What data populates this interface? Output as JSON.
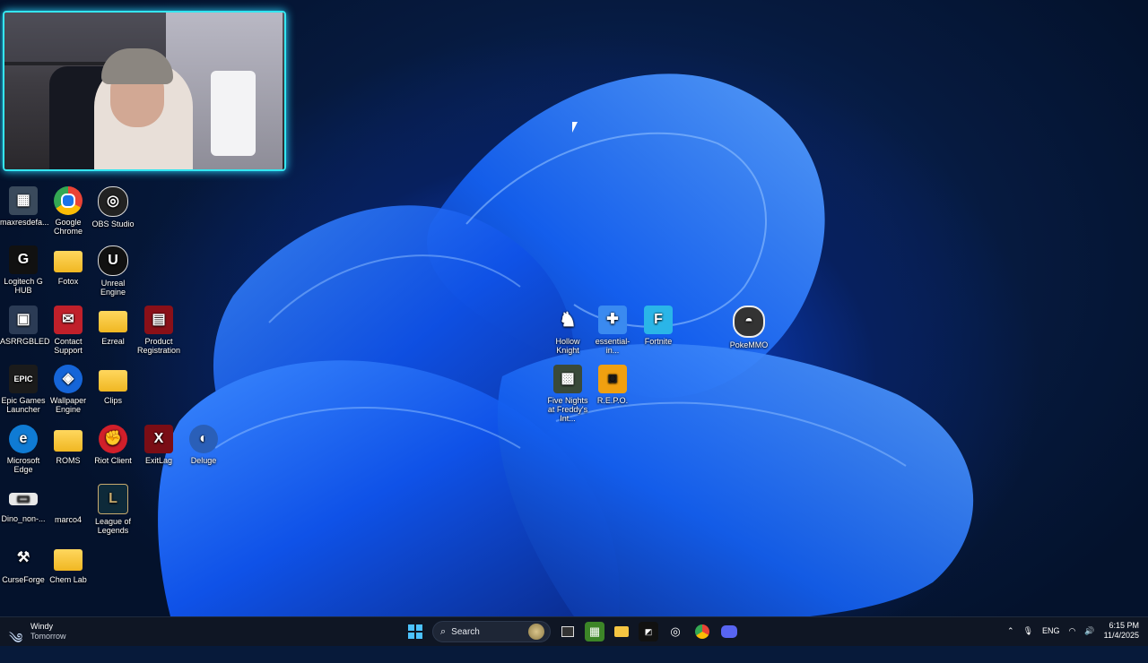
{
  "desktop": {
    "icons": [
      {
        "id": "maxresdefault",
        "label": "maxresdefa...",
        "glyph": "▦",
        "bg": "#3a4a5c"
      },
      {
        "id": "google-chrome",
        "label": "Google Chrome",
        "glyph": "◉",
        "bg": "#1a73e8"
      },
      {
        "id": "obs-studio",
        "label": "OBS Studio",
        "glyph": "◎",
        "bg": "#222"
      },
      {
        "id": "logitech-g-hub",
        "label": "Logitech G HUB",
        "glyph": "G",
        "bg": "#111"
      },
      {
        "id": "fotox",
        "label": "Fotox",
        "glyph": "",
        "bg": "folder"
      },
      {
        "id": "unreal-engine",
        "label": "Unreal Engine",
        "glyph": "U",
        "bg": "#111"
      },
      {
        "id": "asrrgbled",
        "label": "ASRRGBLED",
        "glyph": "▣",
        "bg": "#2b3b55"
      },
      {
        "id": "contact-support",
        "label": "Contact Support",
        "glyph": "✉",
        "bg": "#c0202a"
      },
      {
        "id": "ezreal",
        "label": "Ezreal",
        "glyph": "",
        "bg": "folder"
      },
      {
        "id": "product-registration",
        "label": "Product Registration",
        "glyph": "▤",
        "bg": "#8a1018"
      },
      {
        "id": "epic-games-launcher",
        "label": "Epic Games Launcher",
        "glyph": "EPIC",
        "bg": "#1b1b1b"
      },
      {
        "id": "wallpaper-engine",
        "label": "Wallpaper Engine",
        "glyph": "◈",
        "bg": "#1565d8"
      },
      {
        "id": "clips",
        "label": "Clips",
        "glyph": "",
        "bg": "folder"
      },
      {
        "id": "microsoft-edge",
        "label": "Microsoft Edge",
        "glyph": "e",
        "bg": "#0f7bd4"
      },
      {
        "id": "roms",
        "label": "ROMS",
        "glyph": "",
        "bg": "folder"
      },
      {
        "id": "riot-client",
        "label": "Riot Client",
        "glyph": "✊",
        "bg": "#d11f2a"
      },
      {
        "id": "exitlag",
        "label": "ExitLag",
        "glyph": "X",
        "bg": "#7a0d15"
      },
      {
        "id": "deluge",
        "label": "Deluge",
        "glyph": "◐",
        "bg": "#2a5fb8"
      },
      {
        "id": "dino-non",
        "label": "Dino_non-...",
        "glyph": "▭",
        "bg": "#e8e8e8"
      },
      {
        "id": "marco4",
        "label": "marco4",
        "glyph": "",
        "bg": "#0a1c3a"
      },
      {
        "id": "league-of-legends",
        "label": "League of Legends",
        "glyph": "L",
        "bg": "#0e2a3a"
      },
      {
        "id": "curseforge",
        "label": "CurseForge",
        "glyph": "⚒",
        "bg": "#222"
      },
      {
        "id": "chem-lab",
        "label": "Chem Lab",
        "glyph": "",
        "bg": "folder"
      },
      {
        "id": "hollow-knight",
        "label": "Hollow Knight",
        "glyph": "♞",
        "bg": "#1b1f2a"
      },
      {
        "id": "essential-in",
        "label": "essential-in...",
        "glyph": "✚",
        "bg": "#3a8af0"
      },
      {
        "id": "fortnite",
        "label": "Fortnite",
        "glyph": "F",
        "bg": "#2ab5e8"
      },
      {
        "id": "pokemmo",
        "label": "PokeMMO",
        "glyph": "◓",
        "bg": "#333"
      },
      {
        "id": "five-nights",
        "label": "Five Nights at Freddy's Int...",
        "glyph": "▩",
        "bg": "#3a4a3a"
      },
      {
        "id": "repo",
        "label": "R.E.P.O.",
        "glyph": "◙",
        "bg": "#f0a010"
      }
    ]
  },
  "taskbar": {
    "weather": {
      "title": "Windy",
      "subtitle": "Tomorrow"
    },
    "search_label": "Search",
    "tray": {
      "language": "ENG",
      "time": "6:15 PM",
      "date": "11/4/2025"
    }
  }
}
